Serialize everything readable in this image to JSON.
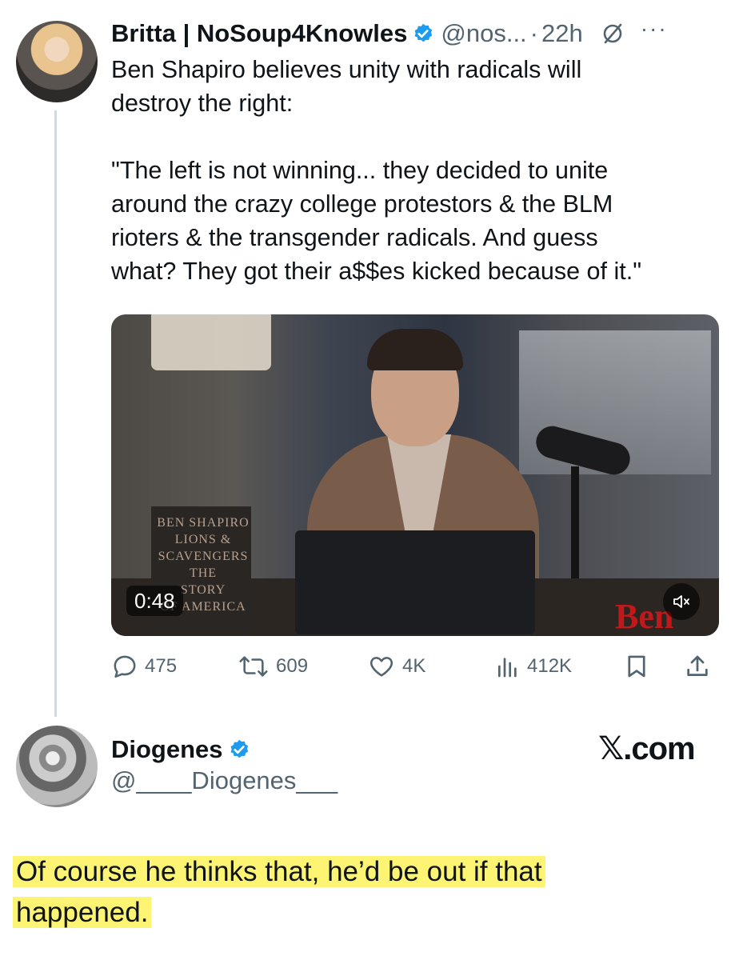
{
  "tweet": {
    "author_name": "Britta | NoSoup4Knowles",
    "handle": "@nos...",
    "separator": "·",
    "time": "22h",
    "more_label": "···",
    "text": "Ben Shapiro believes unity with radicals will\ndestroy the right:\n\n\"The left is not winning... they decided to unite\naround the crazy college protestors & the BLM\nrioters & the transgender radicals. And guess\nwhat? They got their a$$es kicked because of it.\""
  },
  "video": {
    "duration": "0:48",
    "book_title_lines": [
      "BEN SHAPIRO",
      "LIONS & SCAVENGERS",
      "THE",
      "STORY",
      "OF AMERICA"
    ],
    "brand_text": "Ben",
    "mute_icon": "speaker-muted-icon"
  },
  "actions": {
    "replies": "475",
    "reposts": "609",
    "likes": "4K",
    "views": "412K"
  },
  "quote": {
    "author_name": "Diogenes",
    "handle": "@____Diogenes___",
    "site": "𝕏.com"
  },
  "reply": {
    "line1": "Of course he thinks that, he’d be out if that",
    "line2": "happened."
  },
  "colors": {
    "verified_blue": "#1d9bf0",
    "secondary_text": "#536471",
    "highlight": "#fdf473"
  }
}
